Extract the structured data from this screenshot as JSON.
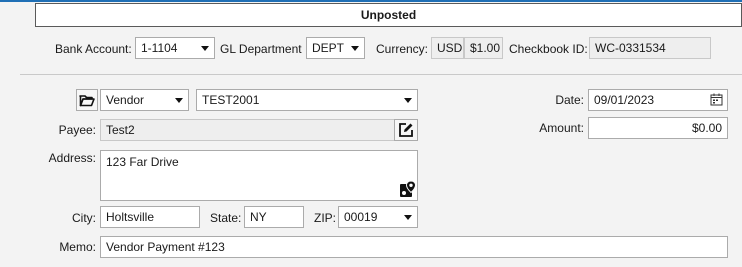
{
  "status": "Unposted",
  "header": {
    "bank_account_label": "Bank Account:",
    "bank_account_value": "1-1104",
    "gl_department_label": "GL Department",
    "gl_department_value": "DEPT",
    "currency_label": "Currency:",
    "currency_code": "USD",
    "currency_rate": "$1.00",
    "checkbook_label": "Checkbook ID:",
    "checkbook_value": "WC-0331534"
  },
  "form": {
    "payee_type_value": "Vendor",
    "vendor_id_value": "TEST2001",
    "payee_label": "Payee:",
    "payee_value": "Test2",
    "address_label": "Address:",
    "address_value": "123 Far Drive",
    "city_label": "City:",
    "city_value": "Holtsville",
    "state_label": "State:",
    "state_value": "NY",
    "zip_label": "ZIP:",
    "zip_value": "00019",
    "memo_label": "Memo:",
    "memo_value": "Vendor Payment #123",
    "date_label": "Date:",
    "date_value": "09/01/2023",
    "amount_label": "Amount:",
    "amount_value": "$0.00"
  },
  "icons": {
    "open": "folder-open-icon",
    "edit": "edit-icon",
    "map": "map-pin-icon",
    "calendar": "calendar-icon",
    "dropdown": "chevron-down-icon"
  },
  "colors": {
    "accent": "#1f6fb5",
    "field_border": "#ababab",
    "readonly_background": "#eeeeee"
  }
}
